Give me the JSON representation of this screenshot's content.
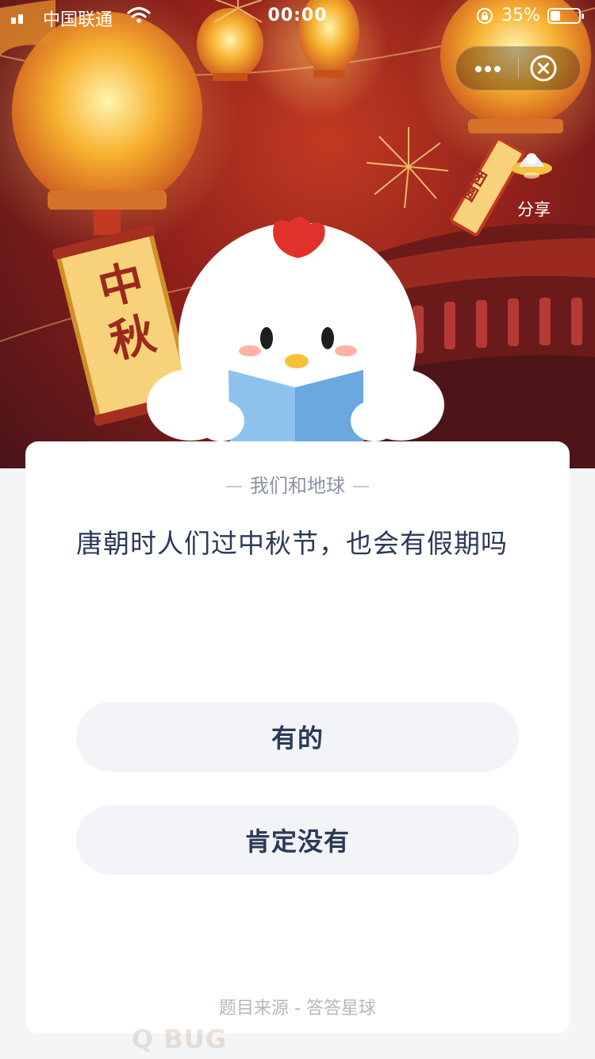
{
  "status_bar": {
    "carrier": "中国联通",
    "time": "00:00",
    "battery_percent": "35%",
    "battery_level": 0.35
  },
  "capsule": {
    "more_icon": "more-dots-icon",
    "close_icon": "close-circle-icon"
  },
  "banner": {
    "scroll_text": "中秋",
    "tag_text": "团圆",
    "share_label": "分享"
  },
  "quiz": {
    "category": "我们和地球",
    "question": "唐朝时人们过中秋节，也会有假期吗",
    "answers": [
      "有的",
      "肯定没有"
    ],
    "source": "题目来源 - 答答星球"
  },
  "watermark": "Q BUG",
  "colors": {
    "banner_red": "#8d1f1a",
    "lantern": "#f4a52a",
    "text_primary": "#2b3a57",
    "text_secondary": "#8c93a3",
    "button_bg": "#f3f4f7",
    "page_bg": "#f4f5f7"
  }
}
